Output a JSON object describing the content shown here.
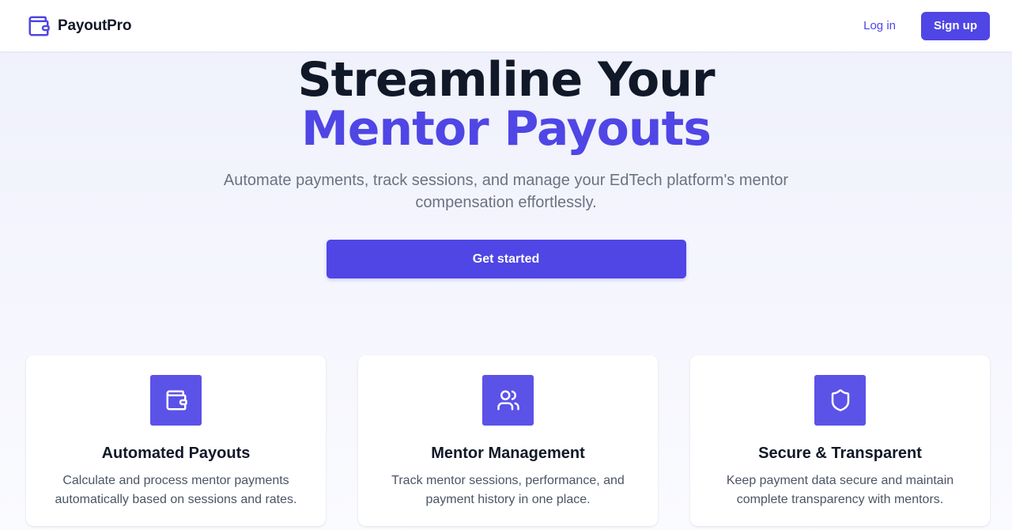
{
  "brand": {
    "name": "PayoutPro",
    "icon": "wallet-icon",
    "accent_color": "#4f46e5"
  },
  "nav": {
    "login_label": "Log in",
    "signup_label": "Sign up"
  },
  "hero": {
    "title_line1": "Streamline Your",
    "title_line2": "Mentor Payouts",
    "subtitle": "Automate payments, track sessions, and manage your EdTech platform's mentor compensation effortlessly.",
    "cta_label": "Get started"
  },
  "features": [
    {
      "icon": "wallet-icon",
      "title": "Automated Payouts",
      "description": "Calculate and process mentor payments automatically based on sessions and rates."
    },
    {
      "icon": "users-icon",
      "title": "Mentor Management",
      "description": "Track mentor sessions, performance, and payment history in one place."
    },
    {
      "icon": "shield-icon",
      "title": "Secure & Transparent",
      "description": "Keep payment data secure and maintain complete transparency with mentors."
    }
  ]
}
